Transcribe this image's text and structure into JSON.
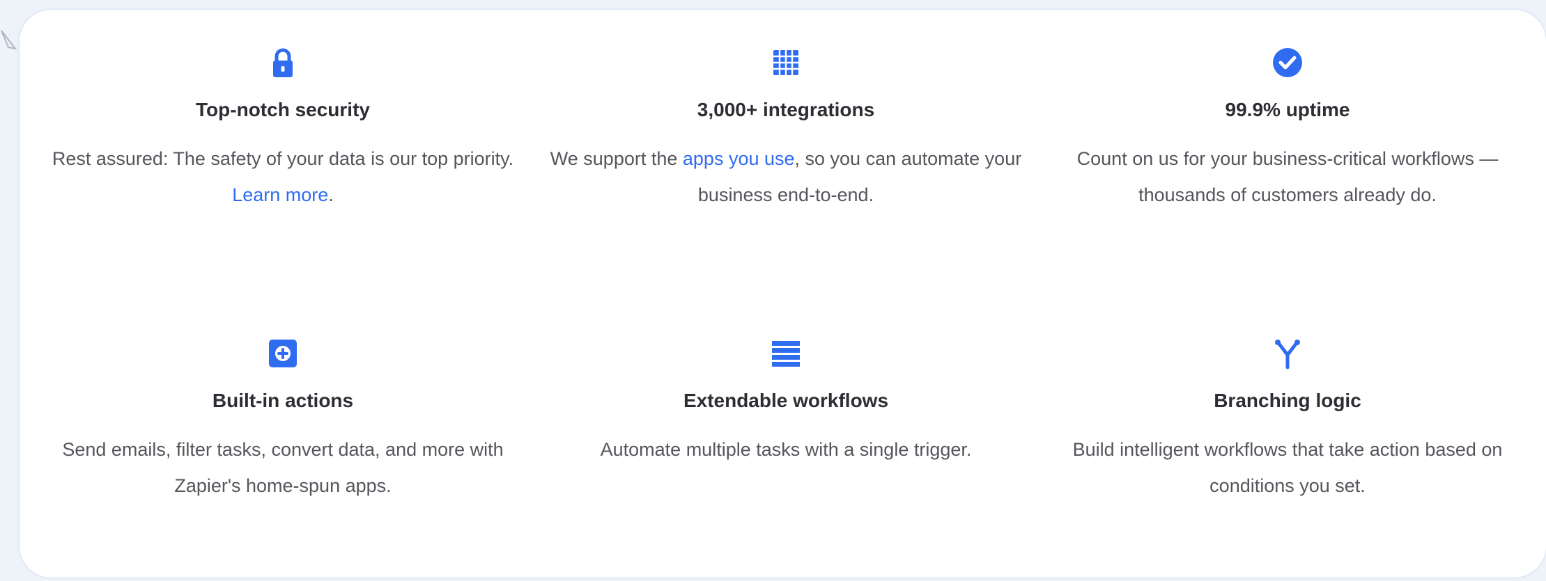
{
  "colors": {
    "accent": "#2f6cf0",
    "title": "#2d2d33",
    "text": "#55565c",
    "background": "#ffffff"
  },
  "features": [
    {
      "icon": "lock-icon",
      "title": "Top-notch security",
      "desc_before": "Rest assured: The safety of your data is our top priority. ",
      "link": "Learn more",
      "desc_after": "."
    },
    {
      "icon": "grid-icon",
      "title": "3,000+ integrations",
      "desc_before": "We support the ",
      "link": "apps you use",
      "desc_after": ", so you can automate your business end-to-end."
    },
    {
      "icon": "check-circle-icon",
      "title": "99.9% uptime",
      "desc": "Count on us for your business-critical workflows —thousands of customers already do."
    },
    {
      "icon": "plus-square-icon",
      "title": "Built-in actions",
      "desc": "Send emails, filter tasks, convert data, and more with Zapier's home-spun apps."
    },
    {
      "icon": "list-icon",
      "title": "Extendable workflows",
      "desc": "Automate multiple tasks with a single trigger."
    },
    {
      "icon": "branch-icon",
      "title": "Branching logic",
      "desc": "Build intelligent workflows that take action based on conditions you set."
    }
  ]
}
